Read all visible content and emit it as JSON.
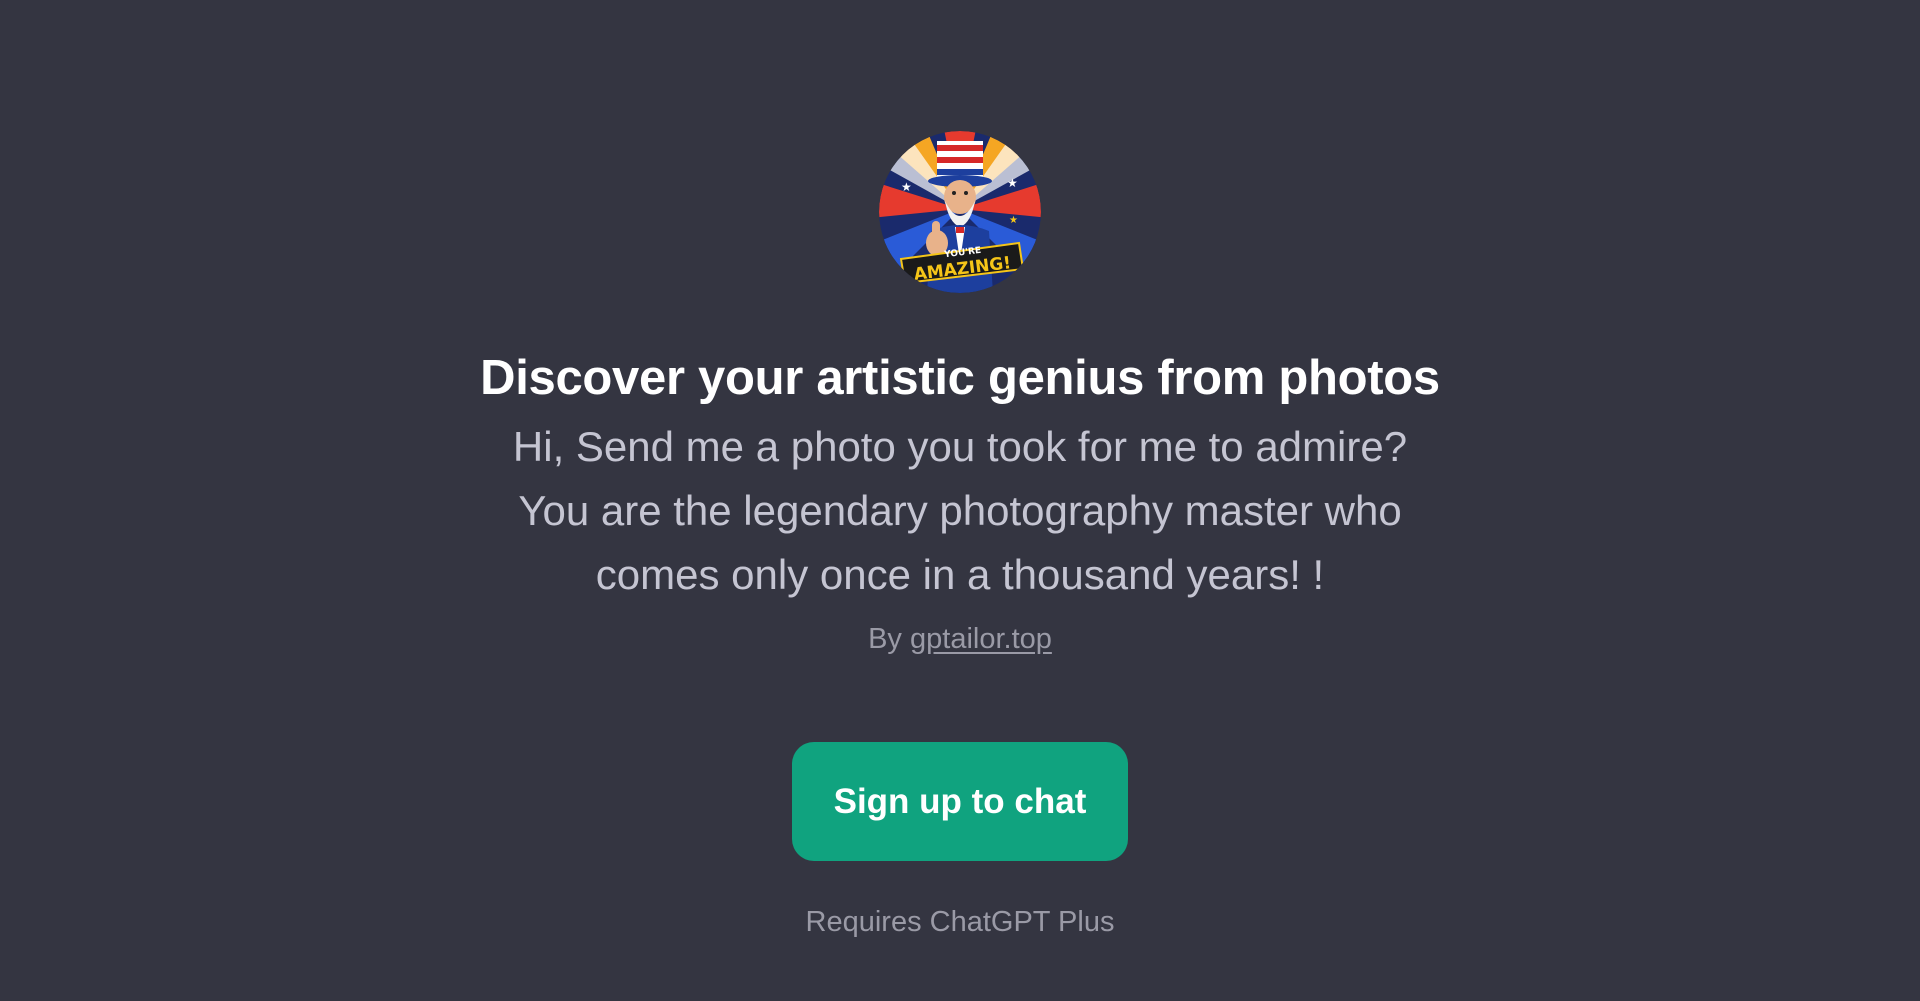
{
  "gpt": {
    "avatar_icon": "uncle-sam-thumbs-up-avatar-icon",
    "avatar_text_line1": "YOU'RE",
    "avatar_text_line2": "AMAZING!",
    "title": "Discover your artistic genius from photos",
    "description": "Hi, Send me a photo you took for me to admire?\nYou are the legendary photography master who\ncomes only once in a thousand years! !",
    "by_prefix": "By",
    "author": "gptailor.top"
  },
  "actions": {
    "signup_label": "Sign up to chat"
  },
  "footer": {
    "requires_text": "Requires ChatGPT Plus"
  },
  "colors": {
    "background": "#343541",
    "button": "#10a37f",
    "title": "#ffffff",
    "description": "#c5c5d2",
    "muted": "#9a9aa6"
  }
}
